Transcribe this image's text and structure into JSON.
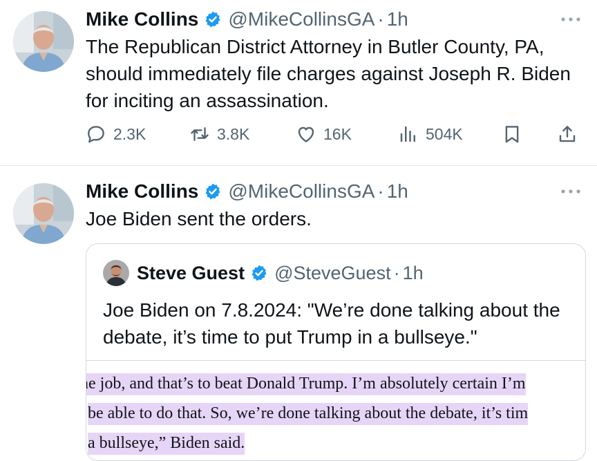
{
  "tweets": [
    {
      "author": "Mike Collins",
      "handle": "@MikeCollinsGA",
      "separator": "·",
      "time": "1h",
      "text": "The Republican District Attorney in Butler County, PA, should immediately file charges against Joseph R. Biden for inciting an assassination.",
      "stats": {
        "replies": "2.3K",
        "reposts": "3.8K",
        "likes": "16K",
        "views": "504K"
      }
    },
    {
      "author": "Mike Collins",
      "handle": "@MikeCollinsGA",
      "separator": "·",
      "time": "1h",
      "text": "Joe Biden sent the orders.",
      "quote": {
        "author": "Steve Guest",
        "handle": "@SteveGuest",
        "separator": "·",
        "time": "1h",
        "text": "Joe Biden on 7.8.2024: \"We’re done talking about the debate, it’s time to put Trump in a bullseye.\"",
        "media_lines": [
          "ne job, and that’s to beat Donald Trump. I’m absolutely certain I’m",
          "be able to do that. So, we’re done talking about the debate, it’s tim",
          "a bullseye,” Biden said."
        ]
      }
    }
  ],
  "colors": {
    "verified": "#1d9bf0",
    "muted": "#536471",
    "highlight": "#e7d5f7",
    "divider": "#e1e5e8"
  },
  "icons": [
    "verified-badge-icon",
    "more-icon",
    "reply-icon",
    "repost-icon",
    "like-icon",
    "views-icon",
    "bookmark-icon",
    "share-icon"
  ]
}
